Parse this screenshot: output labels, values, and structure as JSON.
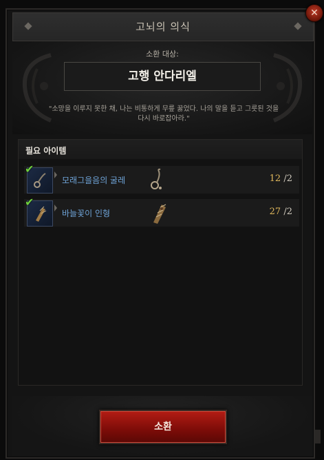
{
  "window": {
    "title": "고뇌의 의식",
    "close_glyph": "✕"
  },
  "summon": {
    "label": "소환 대상:",
    "target": "고행 안다리엘",
    "quote_line1": "\"소망을 이루지 못한 채, 나는 비통하게 무릎 꿇었다. 나의 말을 듣고 그릇된 것을",
    "quote_line2": "다시 바로잡아라.\""
  },
  "items": {
    "header": "필요 아이템",
    "list": [
      {
        "name": "모래그을음의 굴레",
        "have": "12",
        "need": "/2",
        "checked": true,
        "icon": "shackle-icon"
      },
      {
        "name": "바늘꽃이 인형",
        "have": "27",
        "need": "/2",
        "checked": true,
        "icon": "pincushion-doll-icon"
      }
    ]
  },
  "footer": {
    "summon_button": "소환"
  },
  "colors": {
    "accent_red": "#b31c14",
    "item_name_blue": "#6fa4d8",
    "count_gold": "#e0b85c",
    "check_green": "#6fcf3c"
  }
}
